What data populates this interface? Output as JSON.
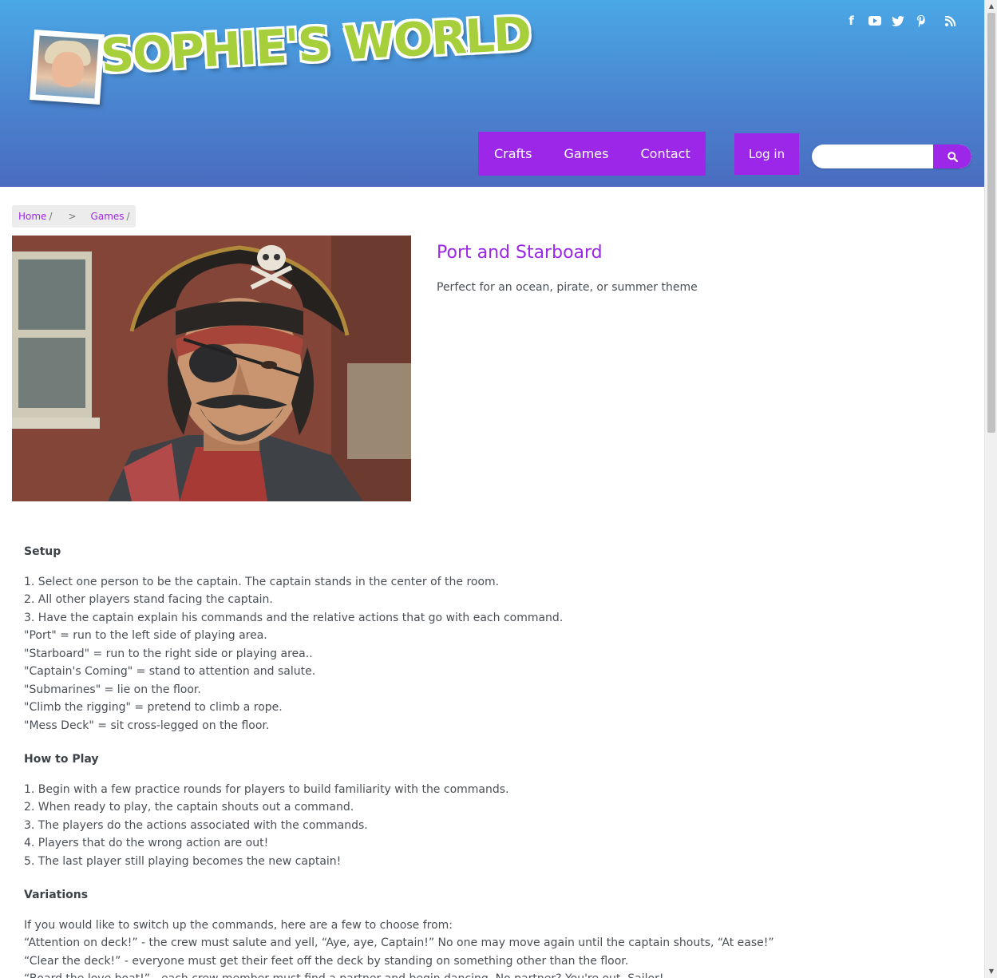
{
  "brand": {
    "logo_text": "SOPHIE'S WORLD"
  },
  "social": {
    "icons": [
      "facebook-icon",
      "youtube-icon",
      "twitter-icon",
      "pinterest-icon",
      "rss-icon"
    ]
  },
  "nav": {
    "items": [
      "Crafts",
      "Games",
      "Contact"
    ]
  },
  "login": "Log in",
  "search": {
    "value": "",
    "placeholder": ""
  },
  "breadcrumb": {
    "home": "Home",
    "sep1": "/",
    "chevron": ">",
    "games": "Games",
    "sep2": "/"
  },
  "article": {
    "title": "Port and Starboard",
    "subtitle": "Perfect for an ocean, pirate, or summer theme",
    "setup": {
      "heading": "Setup",
      "lines": [
        "1. Select one person to be the captain. The captain stands in the center of the room.",
        "2. All other players stand facing the captain.",
        "3. Have the captain explain his commands and the relative actions that go with each command.",
        "\"Port\" = run to the left side of playing area.",
        "\"Starboard\" = run to the right side or playing area..",
        "\"Captain's Coming\" = stand to attention and salute.",
        "\"Submarines\" = lie on the floor.",
        "\"Climb the rigging\" = pretend to climb a rope.",
        "\"Mess Deck\" = sit cross-legged on the floor."
      ]
    },
    "how_to_play": {
      "heading": "How to Play",
      "lines": [
        "1. Begin with a few practice rounds for players to build familiarity with the commands.",
        "2. When ready to play, the captain shouts out a command.",
        "3. The players do the actions associated with the commands.",
        "4. Players that do the wrong action are out!",
        "5. The last player still playing becomes the new captain!"
      ]
    },
    "variations": {
      "heading": "Variations",
      "lines": [
        "If you would like to switch up the commands, here are a few to choose from:",
        "“Attention on deck!” - the crew must salute and yell, “Aye, aye, Captain!” No one may move again until the captain shouts, “At ease!”",
        "“Clear the deck!” - everyone must get their feet off the deck by standing on something other than the floor.",
        "“Board the love boat!” - each crew member must find a partner and begin dancing. No partner? You're out, Sailor!"
      ]
    }
  },
  "colors": {
    "accent": "#9c27e8",
    "header_top": "#4aa8e6",
    "header_bottom": "#4a6cc0",
    "logo_green": "#a7cf3c"
  }
}
